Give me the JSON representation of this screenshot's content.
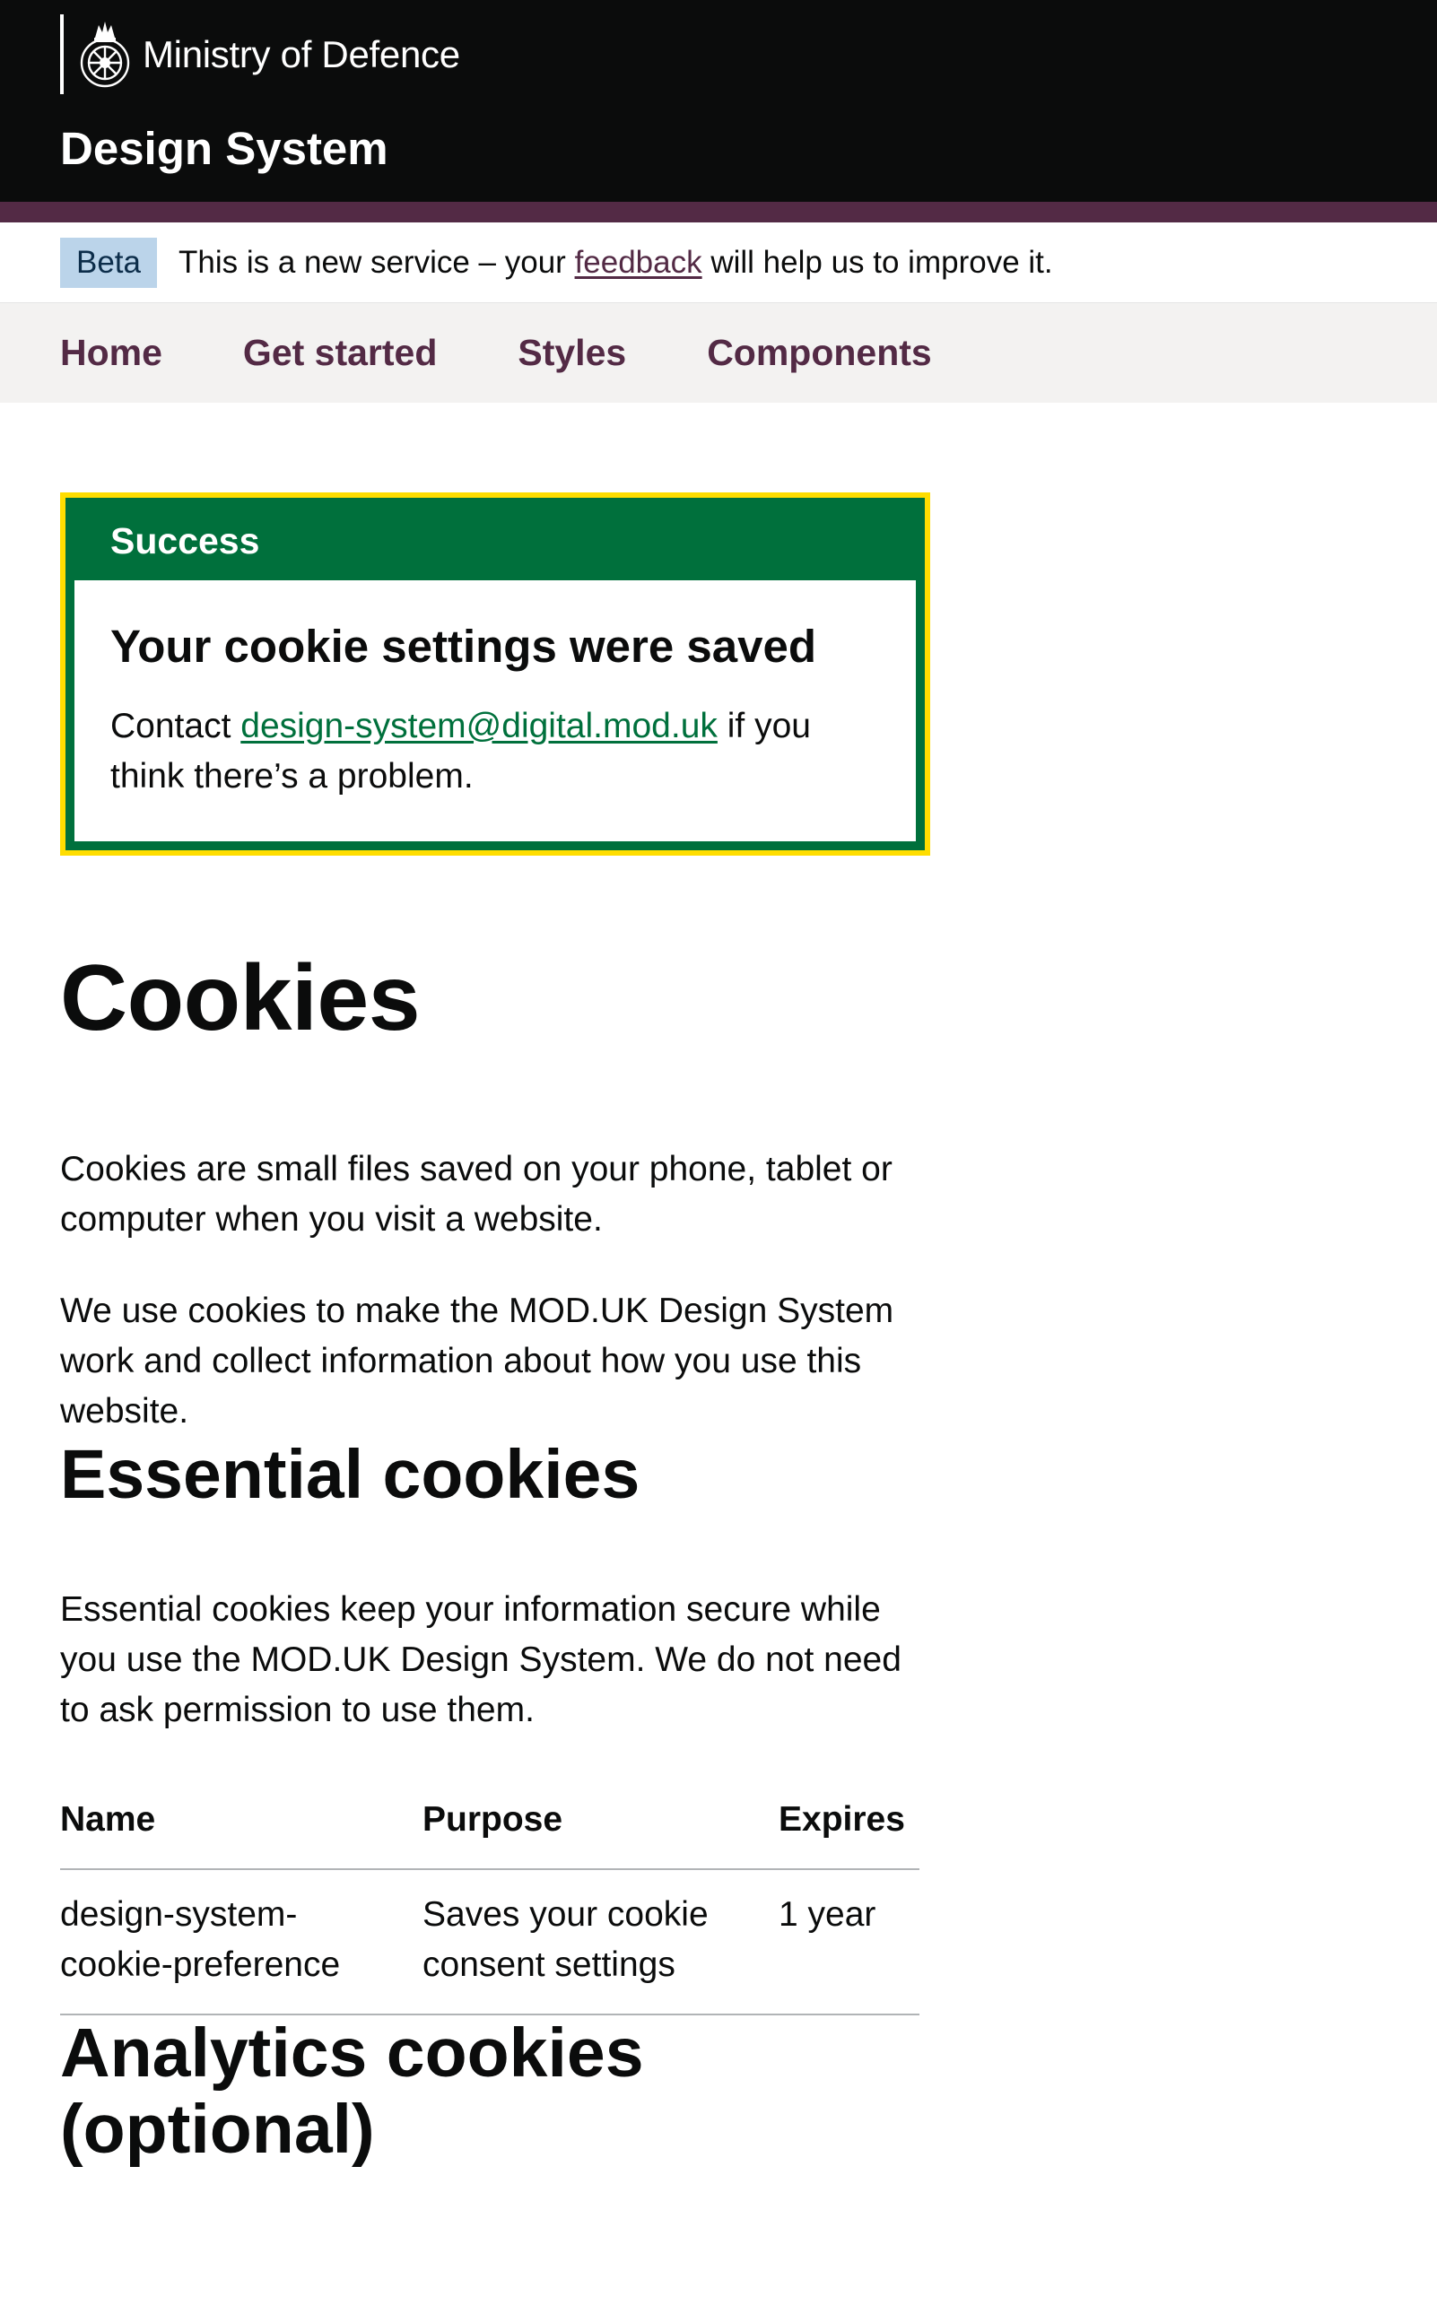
{
  "header": {
    "org_name": "Ministry of Defence",
    "service_name": "Design System",
    "crest_icon": "mod-crest-icon"
  },
  "phase_banner": {
    "tag": "Beta",
    "text_before": "This is a new service – your ",
    "link": "feedback",
    "text_after": " will help us to improve it."
  },
  "nav": {
    "items": [
      {
        "label": "Home"
      },
      {
        "label": "Get started"
      },
      {
        "label": "Styles"
      },
      {
        "label": "Components"
      }
    ]
  },
  "notification": {
    "title": "Success",
    "heading": "Your cookie settings were saved",
    "text_before": "Contact ",
    "link": "design-system@digital.mod.uk",
    "text_after": " if you think there’s a problem."
  },
  "main": {
    "title": "Cookies",
    "intro_1": "Cookies are small files saved on your phone, tablet or computer when you visit a website.",
    "intro_2": "We use cookies to make the MOD.UK Design System work and collect information about how you use this website.",
    "essential_heading": "Essential cookies",
    "essential_text": "Essential cookies keep your information secure while you use the MOD.UK Design System. We do not need to ask permission to use them.",
    "table": {
      "headers": [
        "Name",
        "Purpose",
        "Expires"
      ],
      "rows": [
        [
          "design-system-cookie-preference",
          "Saves your cookie consent settings",
          "1 year"
        ]
      ]
    },
    "analytics_heading": "Analytics cookies (optional)"
  },
  "colors": {
    "header_bg": "#0b0c0c",
    "brand_stripe": "#532a45",
    "nav_bg": "#f3f2f1",
    "success_green": "#00703c",
    "focus_yellow": "#ffdd00",
    "beta_tag_bg": "#bbd4ea"
  }
}
